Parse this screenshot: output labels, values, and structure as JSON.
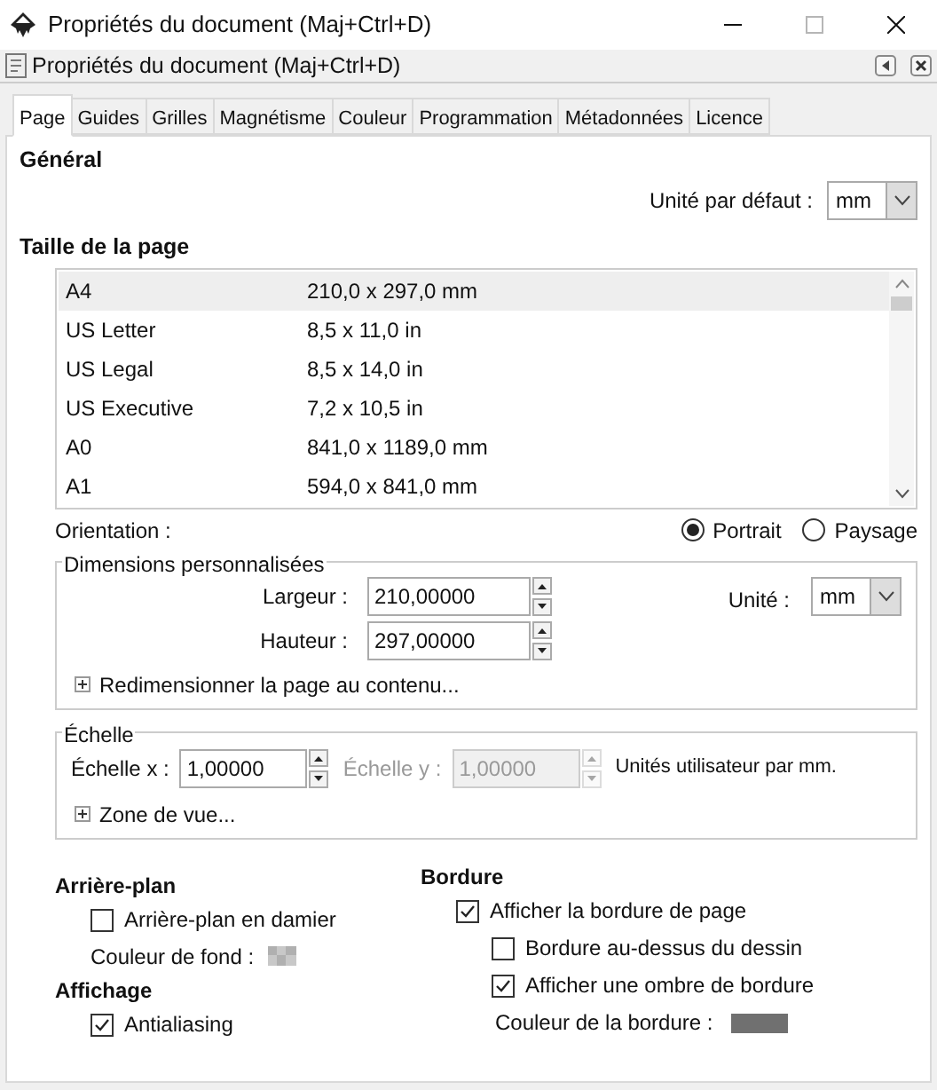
{
  "window": {
    "title": "Propriétés du document (Maj+Ctrl+D)"
  },
  "dock": {
    "title": "Propriétés du document (Maj+Ctrl+D)"
  },
  "tabs": [
    {
      "label": "Page",
      "selected": true
    },
    {
      "label": "Guides",
      "selected": false
    },
    {
      "label": "Grilles",
      "selected": false
    },
    {
      "label": "Magnétisme",
      "selected": false
    },
    {
      "label": "Couleur",
      "selected": false
    },
    {
      "label": "Programmation",
      "selected": false
    },
    {
      "label": "Métadonnées",
      "selected": false
    },
    {
      "label": "Licence",
      "selected": false
    }
  ],
  "general": {
    "heading": "Général",
    "unit_label": "Unité par défaut :",
    "unit_value": "mm"
  },
  "page_size": {
    "heading": "Taille de la page",
    "rows": [
      {
        "name": "A4",
        "size": "210,0 x 297,0 mm",
        "selected": true
      },
      {
        "name": "US Letter",
        "size": "8,5 x 11,0 in",
        "selected": false
      },
      {
        "name": "US Legal",
        "size": "8,5 x 14,0 in",
        "selected": false
      },
      {
        "name": "US Executive",
        "size": "7,2 x 10,5 in",
        "selected": false
      },
      {
        "name": "A0",
        "size": "841,0 x 1189,0 mm",
        "selected": false
      },
      {
        "name": "A1",
        "size": "594,0 x 841,0 mm",
        "selected": false
      }
    ]
  },
  "orientation": {
    "label": "Orientation :",
    "options": [
      {
        "label": "Portrait",
        "selected": true
      },
      {
        "label": "Paysage",
        "selected": false
      }
    ]
  },
  "custom": {
    "legend": "Dimensions personnalisées",
    "fields": [
      {
        "label": "Largeur :",
        "value": "210,00000"
      },
      {
        "label": "Hauteur :",
        "value": "297,00000"
      }
    ],
    "unit_label": "Unité :",
    "unit_value": "mm",
    "expander": "Redimensionner la page au contenu..."
  },
  "scale": {
    "legend": "Échelle",
    "fields": [
      {
        "label": "Échelle x :",
        "value": "1,00000",
        "disabled": false
      },
      {
        "label": "Échelle y :",
        "value": "1,00000",
        "disabled": true
      }
    ],
    "units": "Unités utilisateur par mm.",
    "expander": "Zone de vue..."
  },
  "background": {
    "heading": "Arrière-plan",
    "checkbox": {
      "label": "Arrière-plan en damier",
      "checked": false
    },
    "color_label": "Couleur de fond :"
  },
  "display": {
    "heading": "Affichage",
    "checkbox": {
      "label": "Antialiasing",
      "checked": true
    }
  },
  "border": {
    "heading": "Bordure",
    "checkboxes": [
      {
        "label": "Afficher la bordure de page",
        "checked": true,
        "indent": false
      },
      {
        "label": "Bordure au-dessus du dessin",
        "checked": false,
        "indent": true
      },
      {
        "label": "Afficher une ombre de bordure",
        "checked": true,
        "indent": true
      }
    ],
    "color_label": "Couleur de la bordure :",
    "color": "#707070"
  }
}
